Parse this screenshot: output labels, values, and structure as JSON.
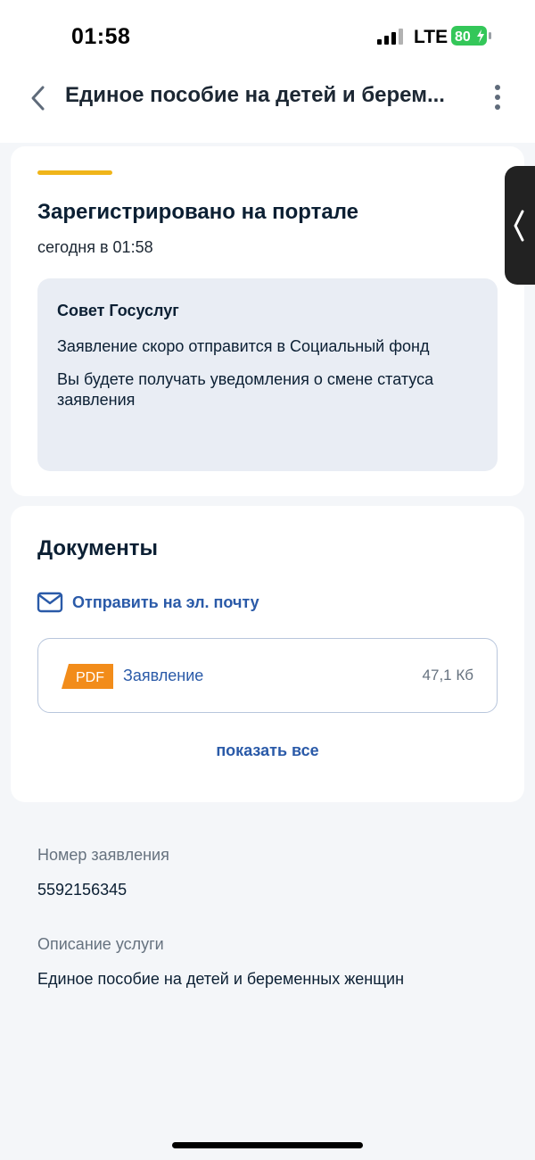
{
  "status_bar": {
    "time": "01:58",
    "network": "LTE",
    "battery": "80"
  },
  "header": {
    "title": "Единое пособие на детей и берем...",
    "back_icon": "chevron-left-icon",
    "more_icon": "more-vertical-icon"
  },
  "status_card": {
    "title": "Зарегистрировано на портале",
    "time": "сегодня в 01:58",
    "tip": {
      "title": "Совет Госуслуг",
      "text1": "Заявление скоро отправится в Социальный фонд",
      "text2": "Вы будете получать уведомления о смене статуса заявления"
    }
  },
  "documents": {
    "title": "Документы",
    "send_mail_label": "Отправить на эл. почту",
    "items": [
      {
        "badge": "PDF",
        "name": "Заявление",
        "size": "47,1 Кб"
      }
    ],
    "show_all": "показать все"
  },
  "info": {
    "number_label": "Номер заявления",
    "number_value": "5592156345",
    "desc_label": "Описание услуги",
    "desc_value": "Единое пособие на детей и беременных женщин"
  },
  "colors": {
    "accent": "#f0b51a",
    "link": "#2a5aa8",
    "pdf": "#f28c1a",
    "battery": "#34c759"
  }
}
